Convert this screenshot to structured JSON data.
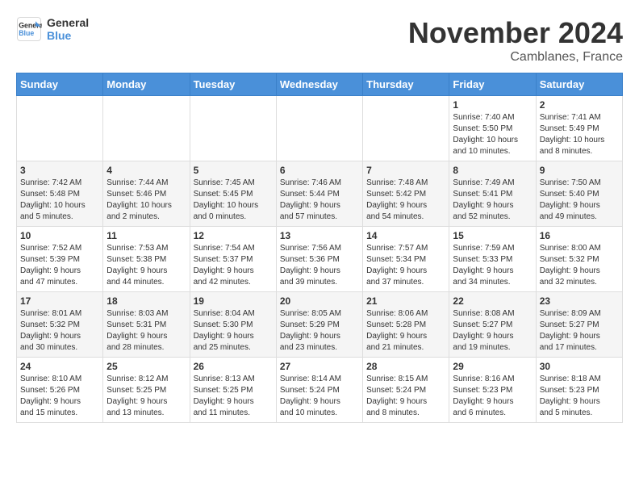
{
  "logo": {
    "line1": "General",
    "line2": "Blue"
  },
  "title": "November 2024",
  "location": "Camblanes, France",
  "header_days": [
    "Sunday",
    "Monday",
    "Tuesday",
    "Wednesday",
    "Thursday",
    "Friday",
    "Saturday"
  ],
  "weeks": [
    [
      {
        "day": "",
        "info": ""
      },
      {
        "day": "",
        "info": ""
      },
      {
        "day": "",
        "info": ""
      },
      {
        "day": "",
        "info": ""
      },
      {
        "day": "",
        "info": ""
      },
      {
        "day": "1",
        "info": "Sunrise: 7:40 AM\nSunset: 5:50 PM\nDaylight: 10 hours\nand 10 minutes."
      },
      {
        "day": "2",
        "info": "Sunrise: 7:41 AM\nSunset: 5:49 PM\nDaylight: 10 hours\nand 8 minutes."
      }
    ],
    [
      {
        "day": "3",
        "info": "Sunrise: 7:42 AM\nSunset: 5:48 PM\nDaylight: 10 hours\nand 5 minutes."
      },
      {
        "day": "4",
        "info": "Sunrise: 7:44 AM\nSunset: 5:46 PM\nDaylight: 10 hours\nand 2 minutes."
      },
      {
        "day": "5",
        "info": "Sunrise: 7:45 AM\nSunset: 5:45 PM\nDaylight: 10 hours\nand 0 minutes."
      },
      {
        "day": "6",
        "info": "Sunrise: 7:46 AM\nSunset: 5:44 PM\nDaylight: 9 hours\nand 57 minutes."
      },
      {
        "day": "7",
        "info": "Sunrise: 7:48 AM\nSunset: 5:42 PM\nDaylight: 9 hours\nand 54 minutes."
      },
      {
        "day": "8",
        "info": "Sunrise: 7:49 AM\nSunset: 5:41 PM\nDaylight: 9 hours\nand 52 minutes."
      },
      {
        "day": "9",
        "info": "Sunrise: 7:50 AM\nSunset: 5:40 PM\nDaylight: 9 hours\nand 49 minutes."
      }
    ],
    [
      {
        "day": "10",
        "info": "Sunrise: 7:52 AM\nSunset: 5:39 PM\nDaylight: 9 hours\nand 47 minutes."
      },
      {
        "day": "11",
        "info": "Sunrise: 7:53 AM\nSunset: 5:38 PM\nDaylight: 9 hours\nand 44 minutes."
      },
      {
        "day": "12",
        "info": "Sunrise: 7:54 AM\nSunset: 5:37 PM\nDaylight: 9 hours\nand 42 minutes."
      },
      {
        "day": "13",
        "info": "Sunrise: 7:56 AM\nSunset: 5:36 PM\nDaylight: 9 hours\nand 39 minutes."
      },
      {
        "day": "14",
        "info": "Sunrise: 7:57 AM\nSunset: 5:34 PM\nDaylight: 9 hours\nand 37 minutes."
      },
      {
        "day": "15",
        "info": "Sunrise: 7:59 AM\nSunset: 5:33 PM\nDaylight: 9 hours\nand 34 minutes."
      },
      {
        "day": "16",
        "info": "Sunrise: 8:00 AM\nSunset: 5:32 PM\nDaylight: 9 hours\nand 32 minutes."
      }
    ],
    [
      {
        "day": "17",
        "info": "Sunrise: 8:01 AM\nSunset: 5:32 PM\nDaylight: 9 hours\nand 30 minutes."
      },
      {
        "day": "18",
        "info": "Sunrise: 8:03 AM\nSunset: 5:31 PM\nDaylight: 9 hours\nand 28 minutes."
      },
      {
        "day": "19",
        "info": "Sunrise: 8:04 AM\nSunset: 5:30 PM\nDaylight: 9 hours\nand 25 minutes."
      },
      {
        "day": "20",
        "info": "Sunrise: 8:05 AM\nSunset: 5:29 PM\nDaylight: 9 hours\nand 23 minutes."
      },
      {
        "day": "21",
        "info": "Sunrise: 8:06 AM\nSunset: 5:28 PM\nDaylight: 9 hours\nand 21 minutes."
      },
      {
        "day": "22",
        "info": "Sunrise: 8:08 AM\nSunset: 5:27 PM\nDaylight: 9 hours\nand 19 minutes."
      },
      {
        "day": "23",
        "info": "Sunrise: 8:09 AM\nSunset: 5:27 PM\nDaylight: 9 hours\nand 17 minutes."
      }
    ],
    [
      {
        "day": "24",
        "info": "Sunrise: 8:10 AM\nSunset: 5:26 PM\nDaylight: 9 hours\nand 15 minutes."
      },
      {
        "day": "25",
        "info": "Sunrise: 8:12 AM\nSunset: 5:25 PM\nDaylight: 9 hours\nand 13 minutes."
      },
      {
        "day": "26",
        "info": "Sunrise: 8:13 AM\nSunset: 5:25 PM\nDaylight: 9 hours\nand 11 minutes."
      },
      {
        "day": "27",
        "info": "Sunrise: 8:14 AM\nSunset: 5:24 PM\nDaylight: 9 hours\nand 10 minutes."
      },
      {
        "day": "28",
        "info": "Sunrise: 8:15 AM\nSunset: 5:24 PM\nDaylight: 9 hours\nand 8 minutes."
      },
      {
        "day": "29",
        "info": "Sunrise: 8:16 AM\nSunset: 5:23 PM\nDaylight: 9 hours\nand 6 minutes."
      },
      {
        "day": "30",
        "info": "Sunrise: 8:18 AM\nSunset: 5:23 PM\nDaylight: 9 hours\nand 5 minutes."
      }
    ]
  ]
}
